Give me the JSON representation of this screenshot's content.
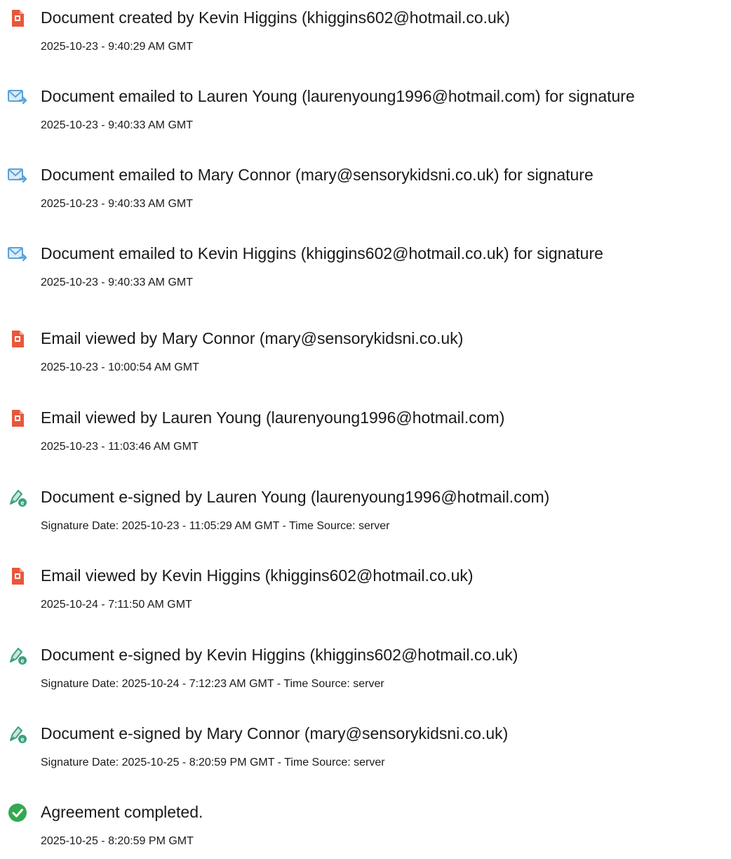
{
  "colors": {
    "created_icon": "#e8573b",
    "email_icon": "#5aa2d8",
    "sign_icon": "#3aa17e",
    "complete_icon": "#34a853",
    "text": "#1a1a1a"
  },
  "events": [
    {
      "icon": "document-icon",
      "title": "Document created by Kevin Higgins (khiggins602@hotmail.co.uk)",
      "detail": "2025-10-23 - 9:40:29 AM GMT"
    },
    {
      "icon": "email-sent-icon",
      "title": "Document emailed to Lauren Young (laurenyoung1996@hotmail.com) for signature",
      "detail": "2025-10-23 - 9:40:33 AM GMT"
    },
    {
      "icon": "email-sent-icon",
      "title": "Document emailed to Mary Connor (mary@sensorykidsni.co.uk) for signature",
      "detail": "2025-10-23 - 9:40:33 AM GMT"
    },
    {
      "icon": "email-sent-icon",
      "title": "Document emailed to Kevin Higgins (khiggins602@hotmail.co.uk) for signature",
      "detail": "2025-10-23 - 9:40:33 AM GMT"
    },
    {
      "icon": "document-icon",
      "title": "Email viewed by Mary Connor (mary@sensorykidsni.co.uk)",
      "detail": "2025-10-23 - 10:00:54 AM GMT"
    },
    {
      "icon": "document-icon",
      "title": "Email viewed by Lauren Young (laurenyoung1996@hotmail.com)",
      "detail": "2025-10-23 - 11:03:46 AM GMT"
    },
    {
      "icon": "e-sign-pen-icon",
      "title": "Document e-signed by Lauren Young (laurenyoung1996@hotmail.com)",
      "detail": "Signature Date: 2025-10-23 - 11:05:29 AM GMT - Time Source: server"
    },
    {
      "icon": "document-icon",
      "title": "Email viewed by Kevin Higgins (khiggins602@hotmail.co.uk)",
      "detail": "2025-10-24 - 7:11:50 AM GMT"
    },
    {
      "icon": "e-sign-pen-icon",
      "title": "Document e-signed by Kevin Higgins (khiggins602@hotmail.co.uk)",
      "detail": "Signature Date: 2025-10-24 - 7:12:23 AM GMT - Time Source: server"
    },
    {
      "icon": "e-sign-pen-icon",
      "title": "Document e-signed by Mary Connor (mary@sensorykidsni.co.uk)",
      "detail": "Signature Date: 2025-10-25 - 8:20:59 PM GMT - Time Source: server"
    },
    {
      "icon": "check-circle-icon",
      "title": "Agreement completed.",
      "detail": "2025-10-25 - 8:20:59 PM GMT"
    }
  ]
}
